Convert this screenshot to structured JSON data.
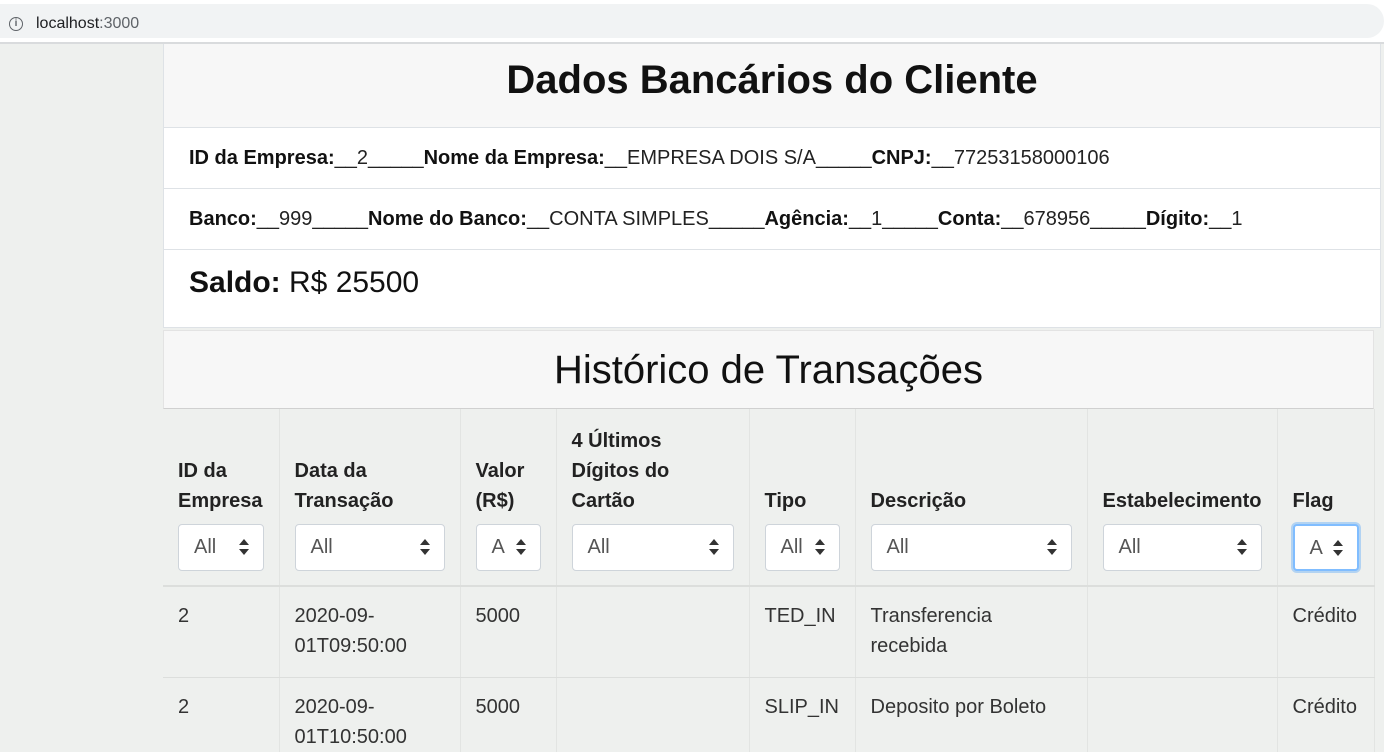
{
  "browser": {
    "url_host": "localhost",
    "url_port": ":3000"
  },
  "client": {
    "title": "Dados Bancários do Cliente",
    "row1": [
      {
        "label": "ID da Empresa:",
        "value": "__2_____"
      },
      {
        "label": "Nome da Empresa:",
        "value": "__EMPRESA DOIS S/A_____"
      },
      {
        "label": "CNPJ:",
        "value": "__77253158000106"
      }
    ],
    "row2": [
      {
        "label": "Banco:",
        "value": "__999_____"
      },
      {
        "label": "Nome do Banco:",
        "value": "__CONTA SIMPLES_____"
      },
      {
        "label": "Agência:",
        "value": "__1_____"
      },
      {
        "label": "Conta:",
        "value": "__678956_____"
      },
      {
        "label": "Dígito:",
        "value": "__1"
      }
    ],
    "saldo_label": "Saldo:",
    "saldo_value": " R$ 25500"
  },
  "history": {
    "title": "Histórico de Transações",
    "columns": [
      {
        "label": "ID da Empresa",
        "filter": "All"
      },
      {
        "label": "Data da Transação",
        "filter": "All"
      },
      {
        "label": "Valor (R$)",
        "filter": "A"
      },
      {
        "label": "4 Últimos Dígitos do Cartão",
        "filter": "All"
      },
      {
        "label": "Tipo",
        "filter": "All"
      },
      {
        "label": "Descrição",
        "filter": "All"
      },
      {
        "label": "Estabelecimento",
        "filter": "All"
      },
      {
        "label": "Flag",
        "filter": "A"
      }
    ],
    "rows": [
      [
        "2",
        "2020-09-01T09:50:00",
        "5000",
        "",
        "TED_IN",
        "Transferencia recebida",
        "",
        "Crédito"
      ],
      [
        "2",
        "2020-09-01T10:50:00",
        "5000",
        "",
        "SLIP_IN",
        "Deposito por Boleto",
        "",
        "Crédito"
      ]
    ]
  }
}
